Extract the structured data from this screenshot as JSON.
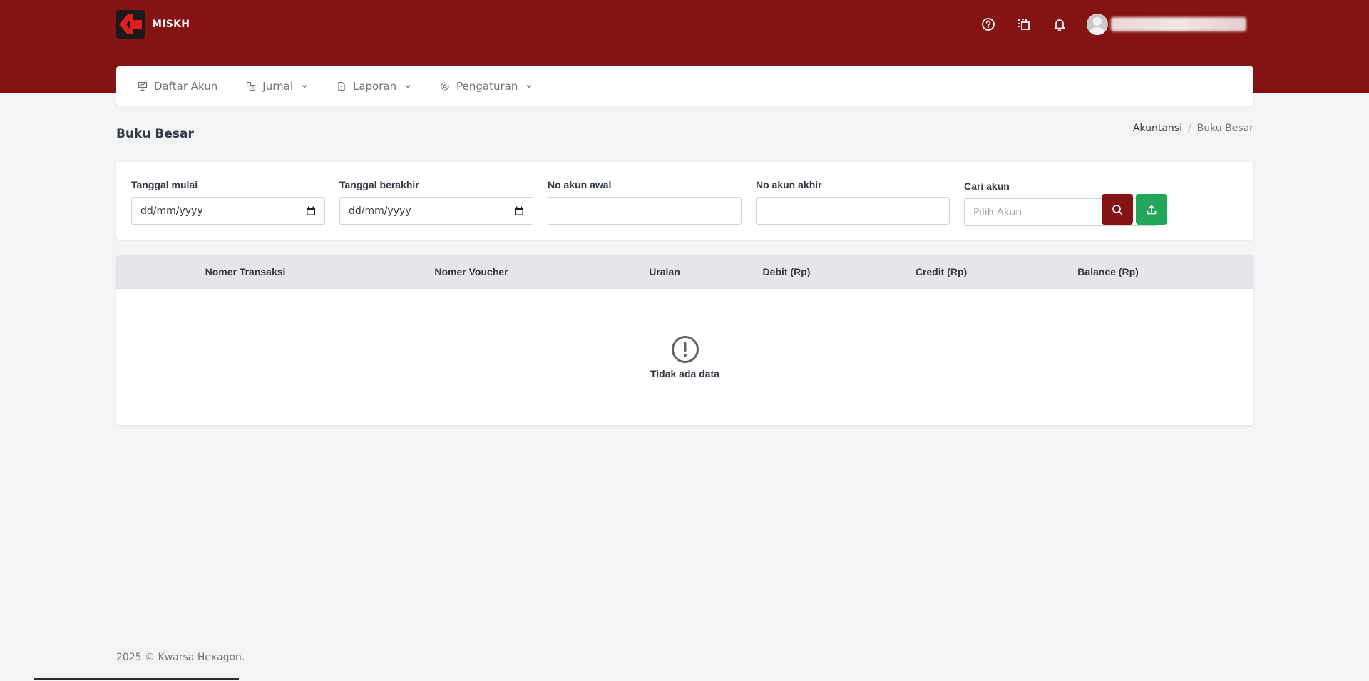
{
  "brand": {
    "name": "MISKH",
    "color": "#861313"
  },
  "header": {
    "icons": [
      "help-icon",
      "copy-icon",
      "bell-icon"
    ],
    "user": {
      "name": ""
    }
  },
  "nav": {
    "items": [
      {
        "label": "Daftar Akun",
        "icon": "presentation-icon",
        "dropdown": false
      },
      {
        "label": "Jurnal",
        "icon": "journal-icon",
        "dropdown": true
      },
      {
        "label": "Laporan",
        "icon": "file-icon",
        "dropdown": true
      },
      {
        "label": "Pengaturan",
        "icon": "gear-icon",
        "dropdown": true
      }
    ]
  },
  "page": {
    "title": "Buku Besar",
    "breadcrumb": [
      "Akuntansi",
      "Buku Besar"
    ]
  },
  "filters": {
    "start_date": {
      "label": "Tanggal mulai",
      "placeholder": "dd/mm/yyyy"
    },
    "end_date": {
      "label": "Tanggal berakhir",
      "placeholder": "dd/mm/yyyy"
    },
    "account_start": {
      "label": "No akun awal",
      "value": ""
    },
    "account_end": {
      "label": "No akun akhir",
      "value": ""
    },
    "account_search": {
      "label": "Cari akun",
      "placeholder": "Pilih Akun"
    },
    "search_color": "#861313",
    "export_color": "#22a65a"
  },
  "table": {
    "columns": [
      "Nomer Transaksi",
      "Nomer Voucher",
      "Uraian",
      "Debit (Rp)",
      "Credit (Rp)",
      "Balance (Rp)"
    ],
    "rows": [],
    "empty_text": "Tidak ada data"
  },
  "footer": {
    "text": "2025 © Kwarsa Hexagon."
  }
}
